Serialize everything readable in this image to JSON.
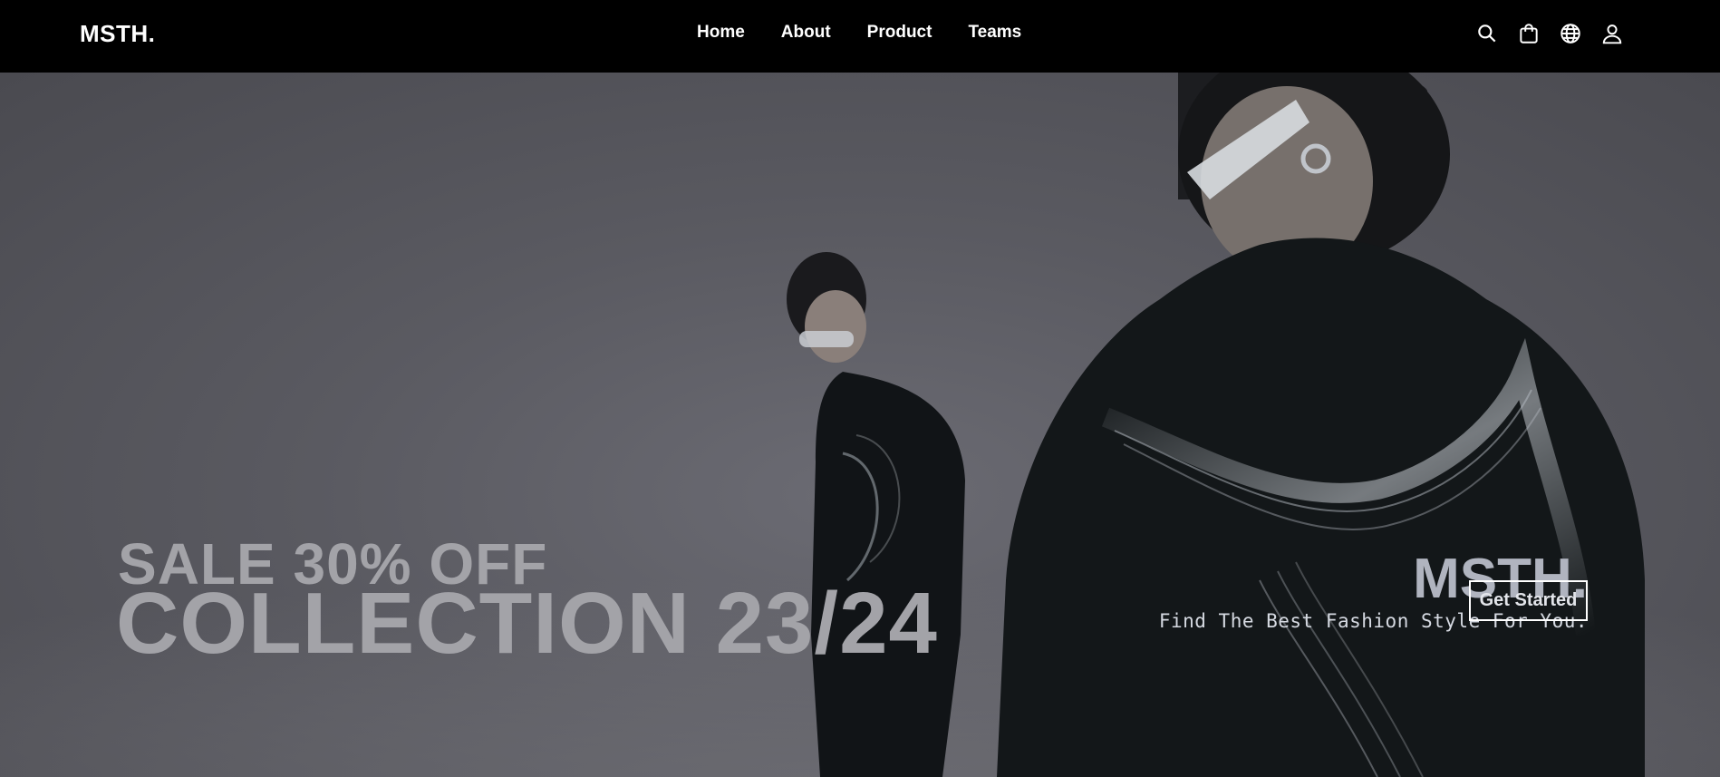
{
  "nav": {
    "logo": "MSTH.",
    "links": [
      "Home",
      "About",
      "Product",
      "Teams"
    ],
    "icons": [
      "search-icon",
      "shopping-bag-icon",
      "globe-icon",
      "user-icon"
    ]
  },
  "hero": {
    "sale_text": "SALE  30% OFF",
    "collection_text": "COLLECTION 23/24",
    "brand": "MSTH.",
    "tagline": "Find The Best Fashion Style For You.",
    "cta_label": "Get Started"
  },
  "colors": {
    "nav_bg": "#000000",
    "hero_bg": "#5a5a61",
    "headline": "#a3a3a8",
    "garment": "#15191c"
  }
}
